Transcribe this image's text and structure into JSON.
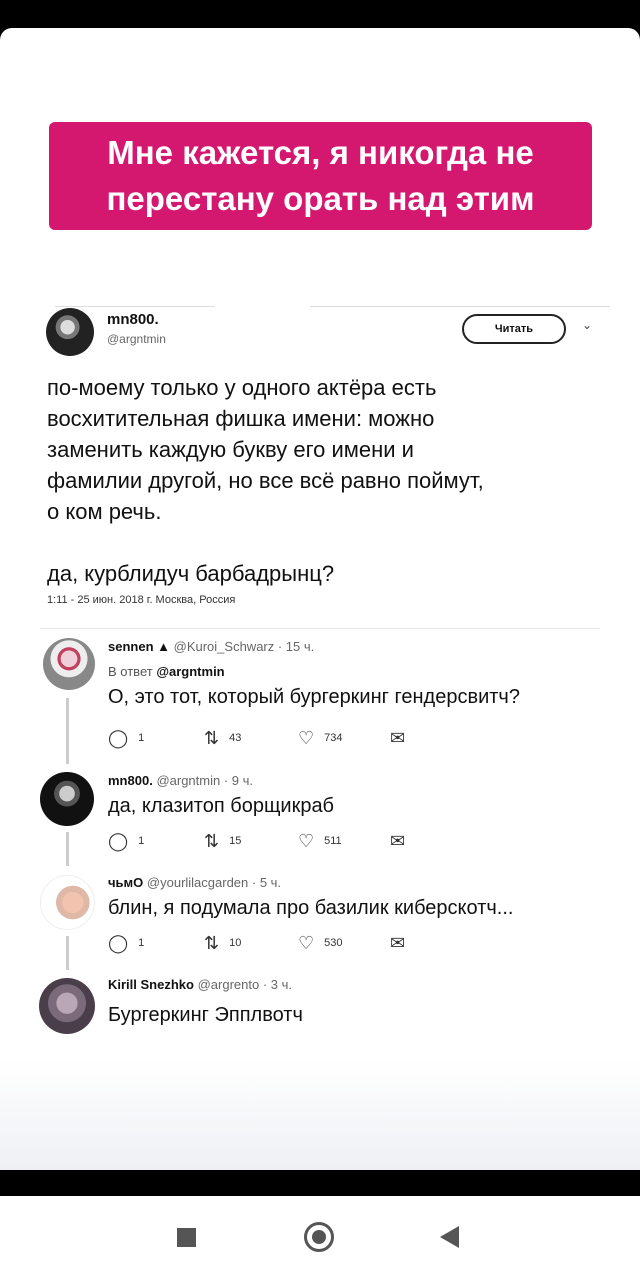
{
  "banner": {
    "line1": "Мне кажется, я никогда не",
    "line2": "перестану орать над этим"
  },
  "tweet": {
    "name": "mn800.",
    "handle": "@argntmin",
    "follow_label": "Читать",
    "text_lines": [
      "по-моему только у одного актёра есть",
      "восхитительная фишка имени: можно",
      "заменить каждую букву его имени и",
      "фамилии другой, но все всё равно поймут,",
      "о ком речь."
    ],
    "text_last": "да, курблидуч барбадрынц?",
    "meta": "1:11 - 25 июн. 2018 г. Москва, Россия"
  },
  "replies": [
    {
      "name": "sennen ▲",
      "handle": "@Kuroi_Schwarz · 15 ч.",
      "reply_to_prefix": "В ответ",
      "reply_to_handle": "@argntmin",
      "text": "О, это тот, который бургеркинг гендерсвитч?",
      "replies": "1",
      "retweets": "43",
      "likes": "734"
    },
    {
      "name": "mn800.",
      "handle": "@argntmin · 9 ч.",
      "text": "да, клазитоп борщикраб",
      "replies": "1",
      "retweets": "15",
      "likes": "511"
    },
    {
      "name": "чьмО",
      "handle": "@yourlilacgarden · 5 ч.",
      "text": "блин, я подумала про базилик киберскотч...",
      "replies": "1",
      "retweets": "10",
      "likes": "530"
    },
    {
      "name": "Kirill Snezhko",
      "handle": "@argrento · 3 ч.",
      "text": "Бургеркинг Эпплвотч"
    }
  ],
  "icons": {
    "reply": "reply-icon",
    "retweet": "retweet-icon",
    "like": "heart-icon",
    "dm": "envelope-icon"
  },
  "colors": {
    "banner_bg": "#d4186f"
  }
}
